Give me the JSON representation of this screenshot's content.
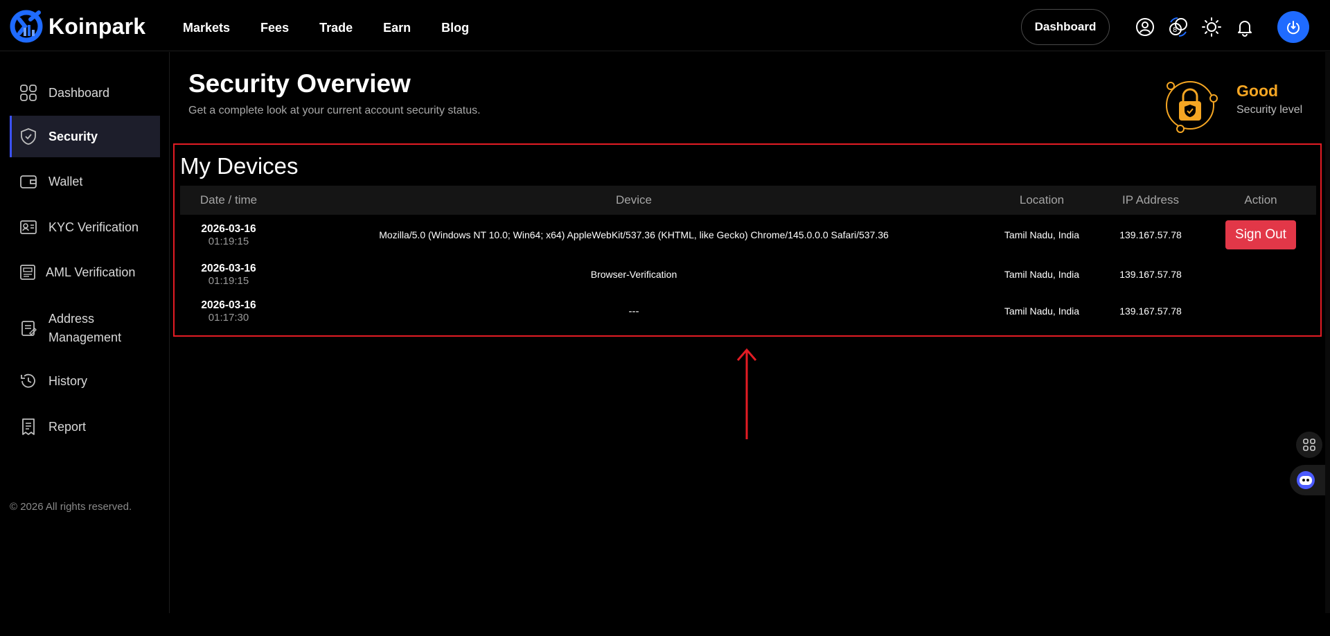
{
  "brand": {
    "name": "Koinpark",
    "accent": "#1f6bff"
  },
  "nav": {
    "items": [
      "Markets",
      "Fees",
      "Trade",
      "Earn",
      "Blog"
    ]
  },
  "header": {
    "dashboard_label": "Dashboard",
    "icons": [
      "user-circle-icon",
      "coins-icon",
      "sun-icon",
      "bell-icon",
      "power-icon"
    ]
  },
  "sidebar": {
    "items": [
      {
        "label": "Dashboard",
        "icon": "grid-icon"
      },
      {
        "label": "Security",
        "icon": "shield-icon",
        "active": true
      },
      {
        "label": "Wallet",
        "icon": "wallet-icon"
      },
      {
        "label": "KYC Verification",
        "icon": "id-card-icon"
      },
      {
        "label": "AML Verification",
        "icon": "id-badge-icon"
      },
      {
        "label": "Address",
        "label2": "Management",
        "icon": "address-book-icon"
      },
      {
        "label": "History",
        "icon": "history-icon"
      },
      {
        "label": "Report",
        "icon": "report-icon"
      }
    ],
    "copyright": "© 2026 All rights reserved."
  },
  "security": {
    "title": "Security Overview",
    "subtitle": "Get a complete look at your current account security status.",
    "level_value": "Good",
    "level_label": "Security level",
    "level_color": "#f5a623"
  },
  "devices": {
    "title": "My Devices",
    "columns": [
      "Date / time",
      "Device",
      "Location",
      "IP Address",
      "Action"
    ],
    "rows": [
      {
        "date": "2026-03-16",
        "time": "01:19:15",
        "device": "Mozilla/5.0 (Windows NT 10.0; Win64; x64) AppleWebKit/537.36 (KHTML, like Gecko) Chrome/145.0.0.0 Safari/537.36",
        "location": "Tamil Nadu, India",
        "ip": "139.167.57.78",
        "action": "Sign Out"
      },
      {
        "date": "2026-03-16",
        "time": "01:19:15",
        "device": "Browser-Verification",
        "location": "Tamil Nadu, India",
        "ip": "139.167.57.78",
        "action": ""
      },
      {
        "date": "2026-03-16",
        "time": "01:17:30",
        "device": "---",
        "location": "Tamil Nadu, India",
        "ip": "139.167.57.78",
        "action": ""
      }
    ],
    "signout_color": "#e23748"
  },
  "annotation": {
    "highlight_color": "#e31c24"
  }
}
